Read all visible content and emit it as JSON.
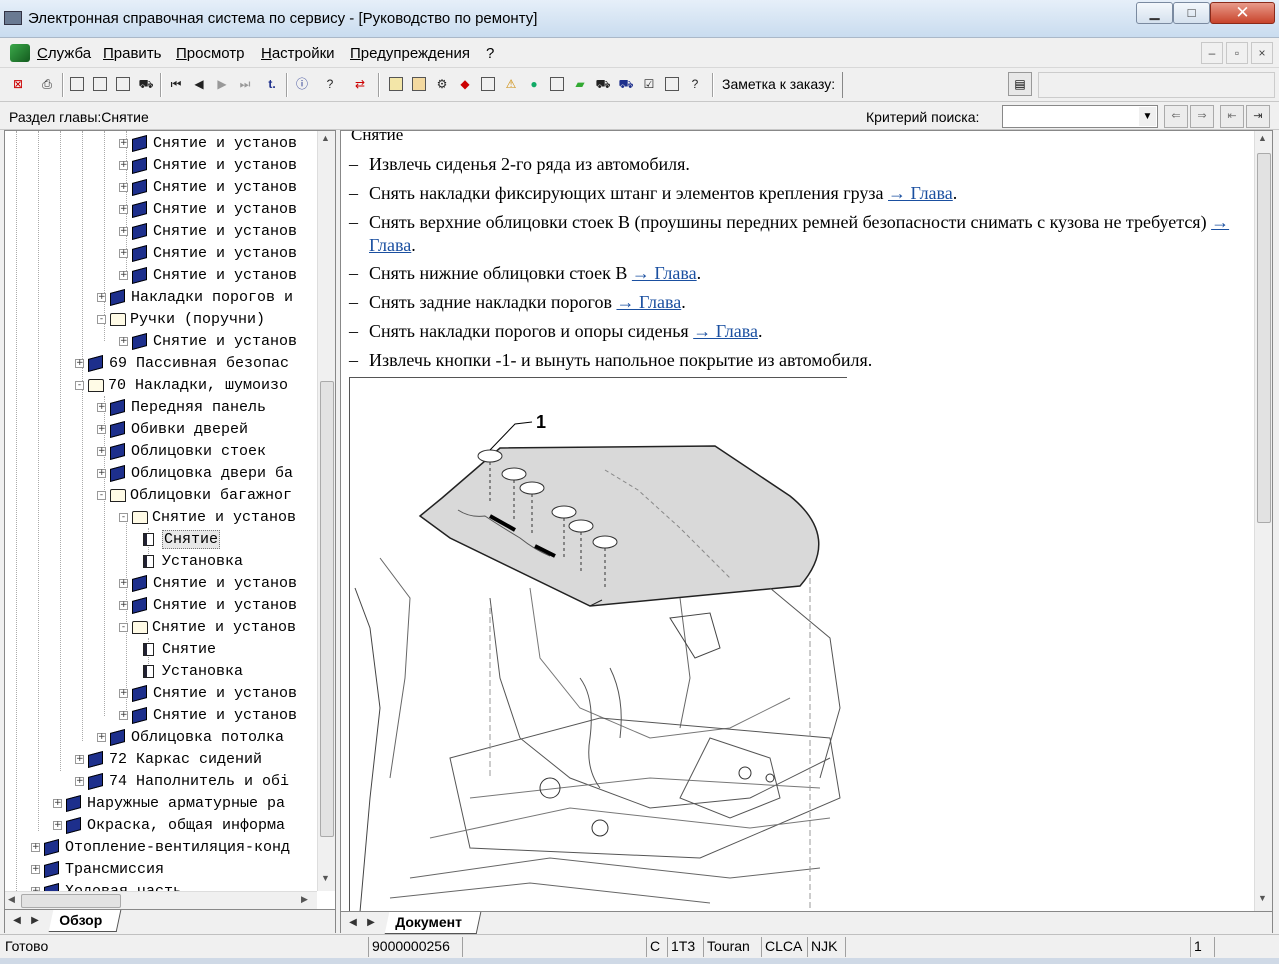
{
  "window": {
    "title": "Электронная справочная система по сервису - [Руководство по ремонту]"
  },
  "menu": {
    "items": [
      "Служба",
      "Править",
      "Просмотр",
      "Настройки",
      "Предупреждения",
      "?"
    ]
  },
  "toolbar": {
    "note_label": "Заметка к заказу:",
    "note_value": ""
  },
  "infobar": {
    "section_label": "Раздел главы:Снятие",
    "criteria_label": "Критерий  поиска:",
    "criteria_value": ""
  },
  "tree": {
    "nodes": [
      {
        "label": "Снятие и установ",
        "level": 4,
        "icon": "book-closed",
        "expander": "+"
      },
      {
        "label": "Снятие и установ",
        "level": 4,
        "icon": "book-closed",
        "expander": "+"
      },
      {
        "label": "Снятие и установ",
        "level": 4,
        "icon": "book-closed",
        "expander": "+"
      },
      {
        "label": "Снятие и установ",
        "level": 4,
        "icon": "book-closed",
        "expander": "+"
      },
      {
        "label": "Снятие и установ",
        "level": 4,
        "icon": "book-closed",
        "expander": "+"
      },
      {
        "label": "Снятие и установ",
        "level": 4,
        "icon": "book-closed",
        "expander": "+"
      },
      {
        "label": "Снятие и установ",
        "level": 4,
        "icon": "book-closed",
        "expander": "+"
      },
      {
        "label": "Накладки порогов и",
        "level": 3,
        "icon": "book-closed",
        "expander": "+"
      },
      {
        "label": "Ручки (поручни)",
        "level": 3,
        "icon": "book-open",
        "expander": "-"
      },
      {
        "label": "Снятие и установ",
        "level": 4,
        "icon": "book-closed",
        "expander": "+"
      },
      {
        "label": "69 Пассивная безопас",
        "level": 2,
        "icon": "book-closed",
        "expander": "+"
      },
      {
        "label": "70 Накладки, шумоизо",
        "level": 2,
        "icon": "book-open",
        "expander": "-"
      },
      {
        "label": "Передняя панель",
        "level": 3,
        "icon": "book-closed",
        "expander": "+"
      },
      {
        "label": "Обивки дверей",
        "level": 3,
        "icon": "book-closed",
        "expander": "+"
      },
      {
        "label": "Облицовки стоек",
        "level": 3,
        "icon": "book-closed",
        "expander": "+"
      },
      {
        "label": "Облицовка двери ба",
        "level": 3,
        "icon": "book-closed",
        "expander": "+"
      },
      {
        "label": "Облицовки багажног",
        "level": 3,
        "icon": "book-open",
        "expander": "-"
      },
      {
        "label": "Снятие и установ",
        "level": 4,
        "icon": "book-open",
        "expander": "-"
      },
      {
        "label": "Снятие",
        "level": 5,
        "icon": "page",
        "expander": "",
        "selected": true
      },
      {
        "label": "Установка",
        "level": 5,
        "icon": "page",
        "expander": ""
      },
      {
        "label": "Снятие и установ",
        "level": 4,
        "icon": "book-closed",
        "expander": "+"
      },
      {
        "label": "Снятие и установ",
        "level": 4,
        "icon": "book-closed",
        "expander": "+"
      },
      {
        "label": "Снятие и установ",
        "level": 4,
        "icon": "book-open",
        "expander": "-"
      },
      {
        "label": "Снятие",
        "level": 5,
        "icon": "page",
        "expander": ""
      },
      {
        "label": "Установка",
        "level": 5,
        "icon": "page",
        "expander": ""
      },
      {
        "label": "Снятие и установ",
        "level": 4,
        "icon": "book-closed",
        "expander": "+"
      },
      {
        "label": "Снятие и установ",
        "level": 4,
        "icon": "book-closed",
        "expander": "+"
      },
      {
        "label": "Облицовка потолка",
        "level": 3,
        "icon": "book-closed",
        "expander": "+"
      },
      {
        "label": "72 Каркас сидений",
        "level": 2,
        "icon": "book-closed",
        "expander": "+"
      },
      {
        "label": "74 Наполнитель и обі",
        "level": 2,
        "icon": "book-closed",
        "expander": "+"
      },
      {
        "label": "Наружные арматурные ра",
        "level": 1,
        "icon": "book-closed",
        "expander": "+"
      },
      {
        "label": "Окраска, общая информа",
        "level": 1,
        "icon": "book-closed",
        "expander": "+"
      },
      {
        "label": "Отопление-вентиляция-конд",
        "level": 0,
        "icon": "book-closed",
        "expander": "+"
      },
      {
        "label": "Трансмиссия",
        "level": 0,
        "icon": "book-closed",
        "expander": "+"
      },
      {
        "label": "Ходовая часть",
        "level": 0,
        "icon": "book-closed",
        "expander": "+"
      }
    ]
  },
  "left_tab": "Обзор",
  "right_tab": "Документ",
  "document": {
    "heading": "Снятие",
    "steps": [
      {
        "text": "Извлечь сиденья 2-го ряда из автомобиля.",
        "link": "",
        "after": ""
      },
      {
        "text": "Снять накладки фиксирующих штанг и элементов крепления груза ",
        "link": "→ Глава",
        "after": "."
      },
      {
        "text": "Снять верхние облицовки стоек B (проушины передних ремней безопасности снимать с кузова не требуется) ",
        "link": "→ Глава",
        "after": "."
      },
      {
        "text": "Снять нижние облицовки стоек B ",
        "link": "→ Глава",
        "after": "."
      },
      {
        "text": "Снять задние накладки порогов ",
        "link": "→ Глава",
        "after": "."
      },
      {
        "text": "Снять накладки порогов и опоры сиденья ",
        "link": "→ Глава",
        "after": "."
      },
      {
        "text": "Извлечь кнопки -1- и вынуть напольное покрытие из автомобиля.",
        "link": "",
        "after": ""
      }
    ],
    "figure_callout": "1"
  },
  "status": {
    "ready": "Готово",
    "doc_number": "9000000256",
    "f1": "C",
    "f2": "1T3",
    "f3": "Touran",
    "f4": "CLCA",
    "f5": "NJK",
    "page": "1"
  }
}
